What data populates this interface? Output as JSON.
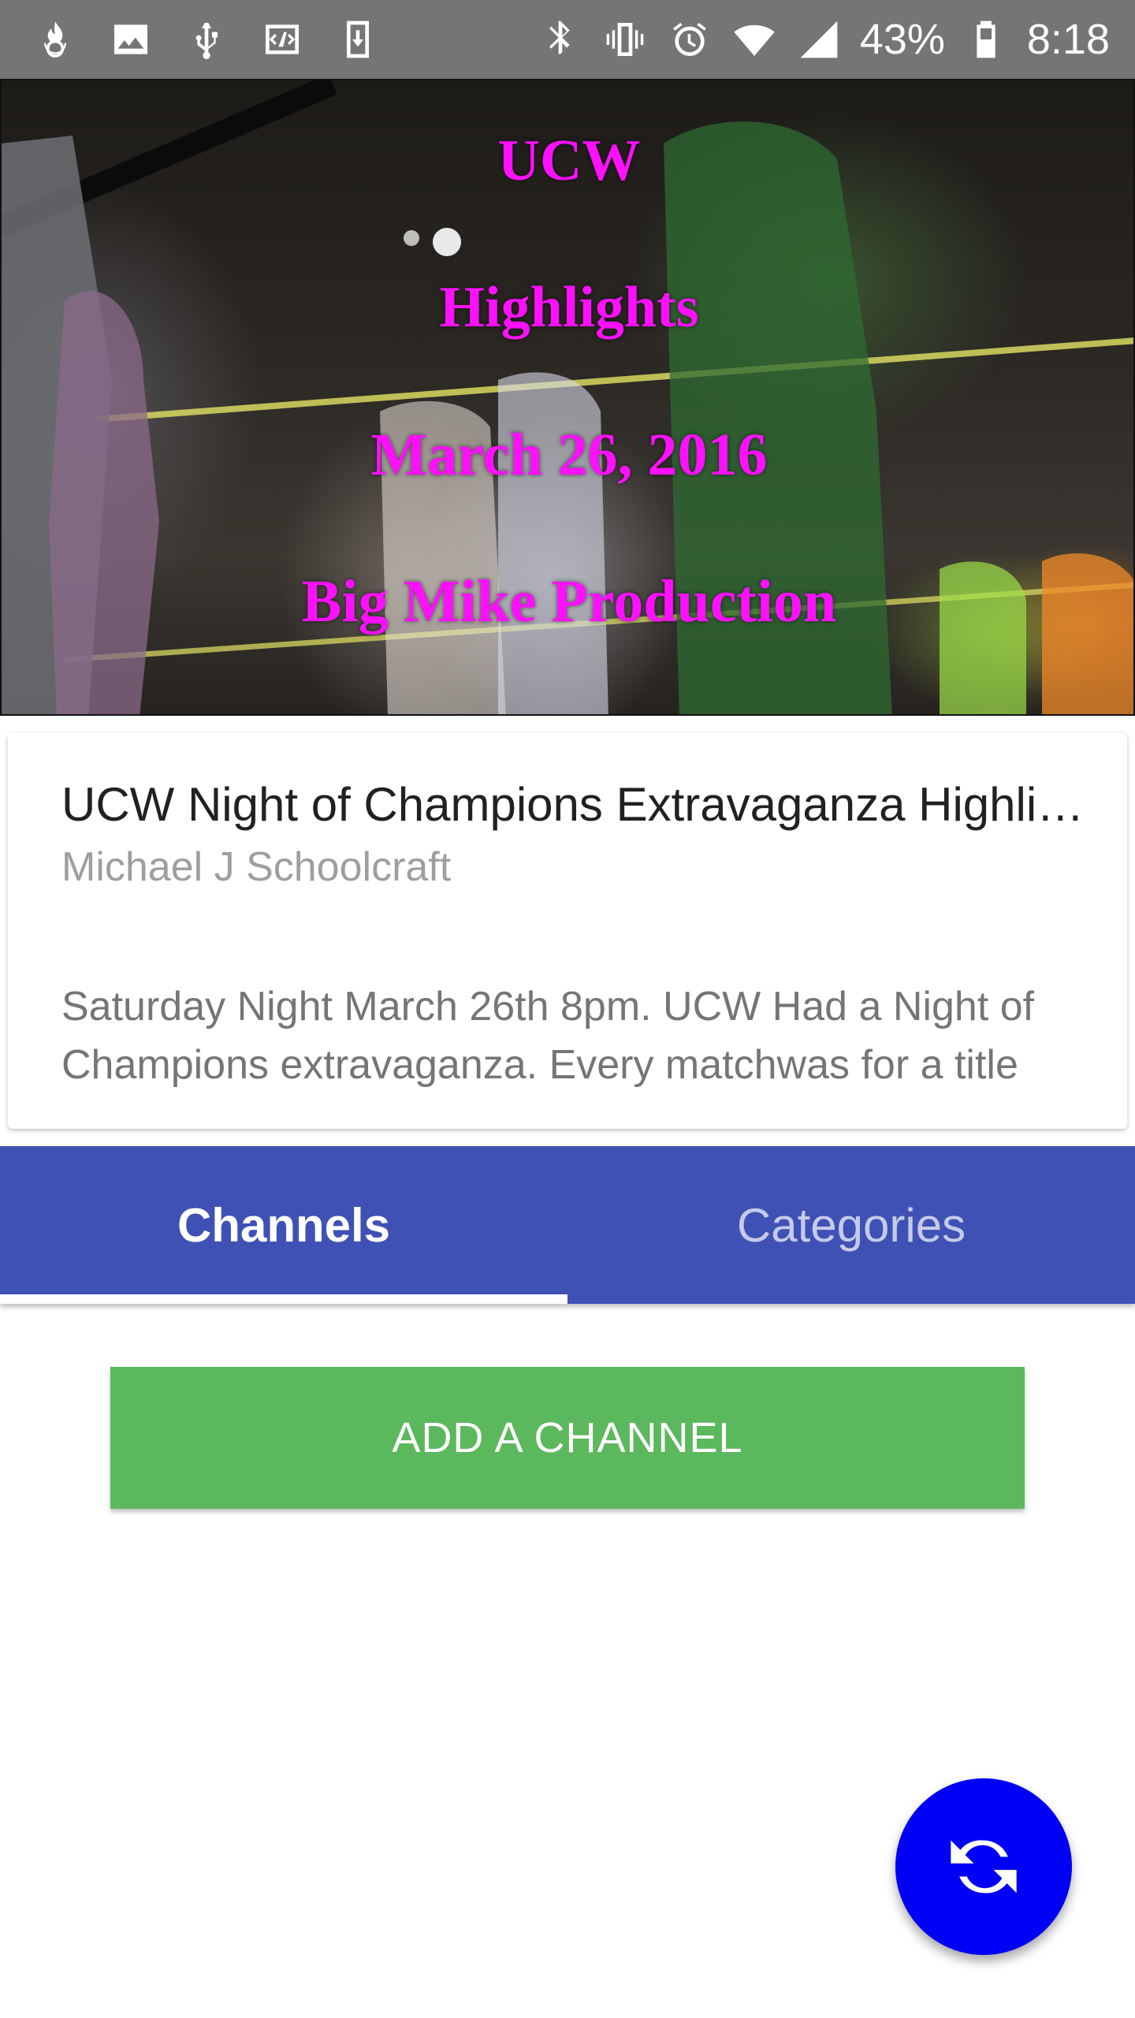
{
  "status_bar": {
    "battery": "43%",
    "time": "8:18",
    "icons_left": [
      "fire-notification-icon",
      "image-icon",
      "usb-icon",
      "code-icon",
      "download-icon"
    ],
    "icons_right": [
      "bluetooth-icon",
      "vibrate-icon",
      "alarm-icon",
      "wifi-icon",
      "signal-icon",
      "battery-icon"
    ]
  },
  "video": {
    "overlay_lines": [
      "UCW",
      "Highlights",
      "March 26, 2016",
      "Big Mike Production"
    ],
    "overlay_color": "#ff10ff",
    "title": "UCW  Night of Champions Extravaganza Highlights",
    "author": "Michael J Schoolcraft",
    "description": "Saturday Night March 26th 8pm. UCW Had a Night of Champions extravaganza. Every matchwas for a title"
  },
  "tabs": [
    {
      "label": "Channels",
      "active": true
    },
    {
      "label": "Categories",
      "active": false
    }
  ],
  "add_channel": {
    "label": "ADD A CHANNEL"
  },
  "fab": {
    "icon": "refresh-icon"
  },
  "colors": {
    "status_bar": "#757575",
    "tab_bar": "#3f51b5",
    "add_button": "#5cb85c",
    "fab": "#0000f5"
  }
}
